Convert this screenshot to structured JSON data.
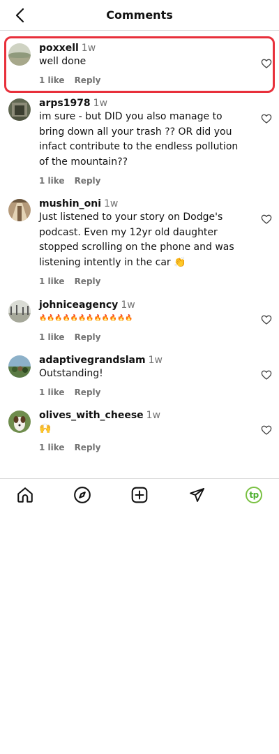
{
  "header": {
    "title": "Comments"
  },
  "comments": [
    {
      "username": "poxxell",
      "time": "1w",
      "text": "well done",
      "likes": "1 like",
      "reply": "Reply"
    },
    {
      "username": "arps1978",
      "time": "1w",
      "text": "im sure - but DID you also manage to bring down all your trash ?? OR did you infact contribute to the endless pollution of the mountain??",
      "likes": "1 like",
      "reply": "Reply"
    },
    {
      "username": "mushin_oni",
      "time": "1w",
      "text": "Just listened to your story on Dodge's podcast. Even my 12yr old daughter stopped scrolling on the phone and was listening intently in the car 👏",
      "likes": "1 like",
      "reply": "Reply"
    },
    {
      "username": "johniceagency",
      "time": "1w",
      "text": "🔥🔥🔥🔥🔥🔥🔥🔥🔥🔥🔥🔥",
      "likes": "1 like",
      "reply": "Reply"
    },
    {
      "username": "adaptivegrandslam",
      "time": "1w",
      "text": "Outstanding!",
      "likes": "1 like",
      "reply": "Reply"
    },
    {
      "username": "olives_with_cheese",
      "time": "1w",
      "text": "🙌",
      "likes": "1 like",
      "reply": "Reply"
    }
  ],
  "nav": {
    "items": [
      "home-icon",
      "explore-icon",
      "create-icon",
      "direct-icon",
      "profile-icon"
    ],
    "profile_text": "tp",
    "profile_color": "#7ac143"
  },
  "highlight_color": "#e8303b"
}
